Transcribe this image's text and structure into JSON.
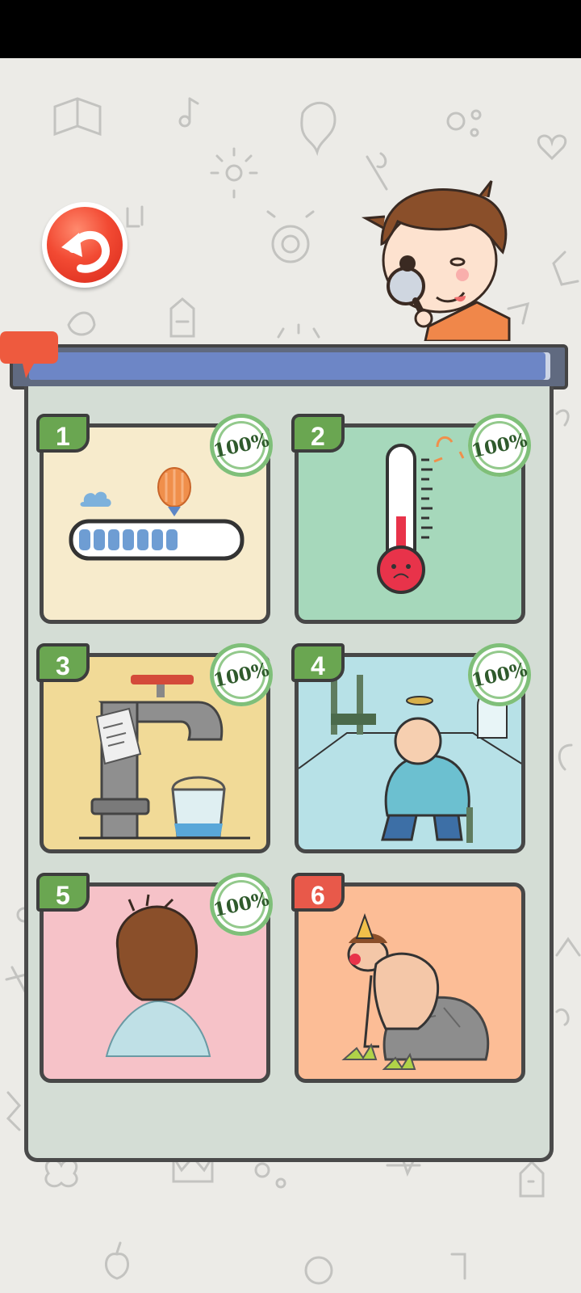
{
  "game": {
    "level_progress": 0.99,
    "levels": [
      {
        "number": "1",
        "completion": "100%",
        "status": "completed",
        "theme": "loading-bar-balloon",
        "card_color": "#f7ebcc"
      },
      {
        "number": "2",
        "completion": "100%",
        "status": "completed",
        "theme": "thermometer",
        "card_color": "#a6d8bb"
      },
      {
        "number": "3",
        "completion": "100%",
        "status": "completed",
        "theme": "faucet-bucket",
        "card_color": "#f1da97"
      },
      {
        "number": "4",
        "completion": "100%",
        "status": "completed",
        "theme": "gym-man",
        "card_color": "#b7e1e7"
      },
      {
        "number": "5",
        "completion": "100%",
        "status": "completed",
        "theme": "haircut",
        "card_color": "#f6c2c8"
      },
      {
        "number": "6",
        "completion": "",
        "status": "current",
        "theme": "thinker-statue",
        "card_color": "#fcbd96"
      }
    ],
    "colors": {
      "completed_tag": "#6aa651",
      "current_tag": "#e8594a",
      "progress_fill": "#6d86c6",
      "back_button": "#f24a33"
    },
    "icons": [
      "back-arrow-icon",
      "chat-bubble-icon",
      "magnifying-glass-icon"
    ]
  }
}
